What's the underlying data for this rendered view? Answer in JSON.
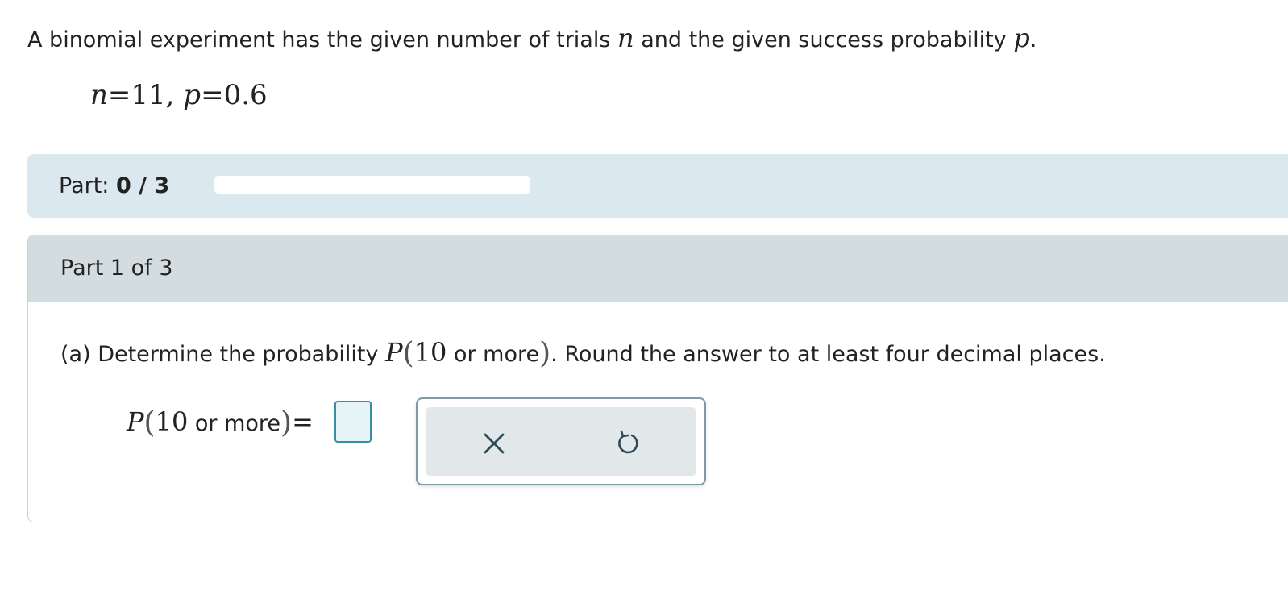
{
  "problem": {
    "intro_text": "A binomial experiment has the given number of trials",
    "n_symbol": "n",
    "intro_mid": "and the given success probability",
    "p_symbol": "p",
    "intro_end": ".",
    "given": {
      "n_var": "n",
      "eq1": "=",
      "n_value": "11",
      "comma": ",",
      "p_var": "p",
      "eq2": "=",
      "p_value": "0.6"
    }
  },
  "progress": {
    "label": "Part:",
    "value_text": "0 / 3",
    "completed": 0,
    "total": 3
  },
  "part": {
    "header": "Part 1 of 3",
    "question": {
      "prefix": "(a) Determine the probability",
      "P": "P",
      "open": "(",
      "num": "10",
      "words": "or more",
      "close": ")",
      "suffix": ". Round the answer to at least four decimal places."
    },
    "answer": {
      "P": "P",
      "open": "(",
      "num": "10",
      "words": "or more",
      "close": ")",
      "equals": "=",
      "value": ""
    }
  },
  "tools": {
    "clear_icon": "x-icon",
    "undo_icon": "undo-icon"
  },
  "colors": {
    "progress_bg": "#dce8f0",
    "part_header_bg": "#d3dcdf",
    "input_border": "#3a8ea0",
    "icon_color": "#2e4a55"
  }
}
